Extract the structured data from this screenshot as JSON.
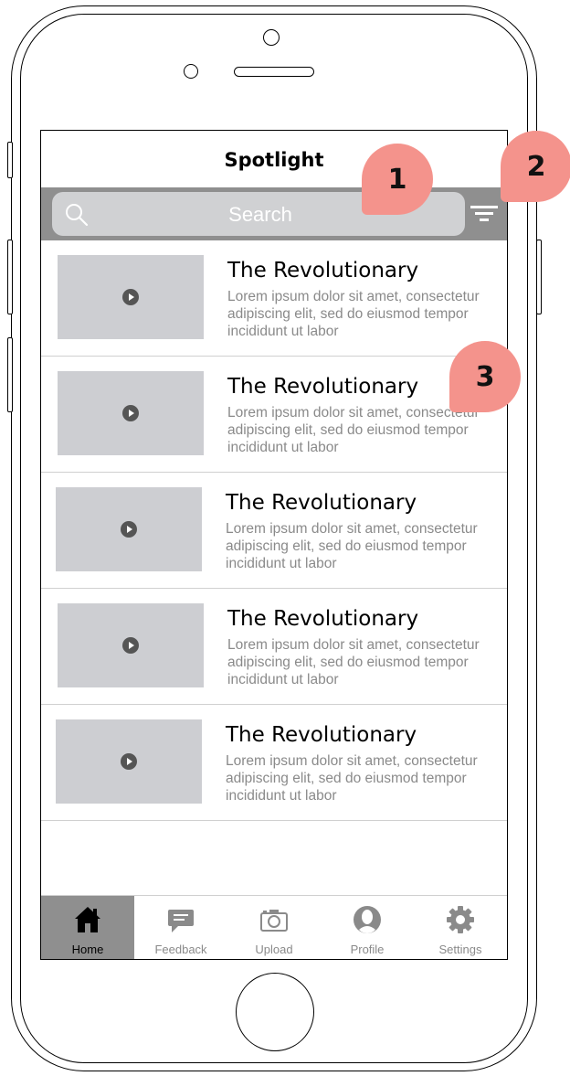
{
  "header": {
    "title": "Spotlight"
  },
  "search": {
    "placeholder": "Search"
  },
  "list": [
    {
      "title": "The Revolutionary",
      "desc": "Lorem ipsum dolor sit amet, consectetur adipiscing elit, sed do eiusmod tempor incididunt ut labor"
    },
    {
      "title": "The Revolutionary",
      "desc": "Lorem ipsum dolor sit amet, consectetur adipiscing elit, sed do eiusmod tempor incididunt ut labor"
    },
    {
      "title": "The Revolutionary",
      "desc": "Lorem ipsum dolor sit amet, consectetur adipiscing elit, sed do eiusmod tempor incididunt ut labor"
    },
    {
      "title": "The Revolutionary",
      "desc": "Lorem ipsum dolor sit amet, consectetur adipiscing elit, sed do eiusmod tempor incididunt ut labor"
    },
    {
      "title": "The Revolutionary",
      "desc": "Lorem ipsum dolor sit amet, consectetur adipiscing elit, sed do eiusmod tempor incididunt ut labor"
    }
  ],
  "tabs": [
    {
      "label": "Home",
      "icon": "home-icon",
      "active": true
    },
    {
      "label": "Feedback",
      "icon": "feedback-icon"
    },
    {
      "label": "Upload",
      "icon": "camera-icon"
    },
    {
      "label": "Profile",
      "icon": "profile-icon"
    },
    {
      "label": "Settings",
      "icon": "gear-icon"
    }
  ],
  "callouts": [
    "1",
    "2",
    "3"
  ],
  "colors": {
    "bar": "#8f8f8f",
    "thumb": "#cdced2",
    "callout": "#f4938c"
  }
}
